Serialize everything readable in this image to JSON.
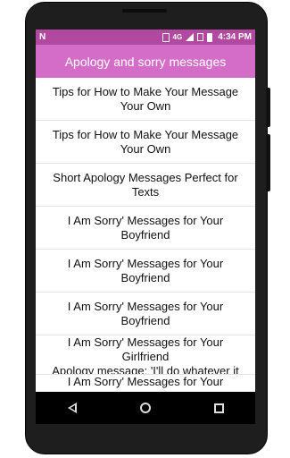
{
  "status_bar": {
    "app_icon": "N",
    "network": "4G",
    "time": "4:34 PM",
    "icons": [
      "vibrate-icon",
      "signal-icon",
      "sim-icon",
      "battery-icon"
    ]
  },
  "app_bar": {
    "title": "Apology and sorry messages",
    "color": "#d46dc7"
  },
  "list": {
    "items": [
      "Tips for How to Make Your Message Your Own",
      "Tips for How to Make Your Message Your Own",
      "Short Apology Messages Perfect for Texts",
      "I Am Sorry' Messages for Your Boyfriend",
      "I Am Sorry' Messages for Your Boyfriend",
      "I Am Sorry' Messages for Your Boyfriend",
      "I Am Sorry' Messages for Your Girlfriend\nApology message: 'I'll do whatever it",
      "I Am Sorry' Messages for Your"
    ]
  },
  "nav": {
    "icons": [
      "back-icon",
      "home-icon",
      "recents-icon"
    ]
  }
}
